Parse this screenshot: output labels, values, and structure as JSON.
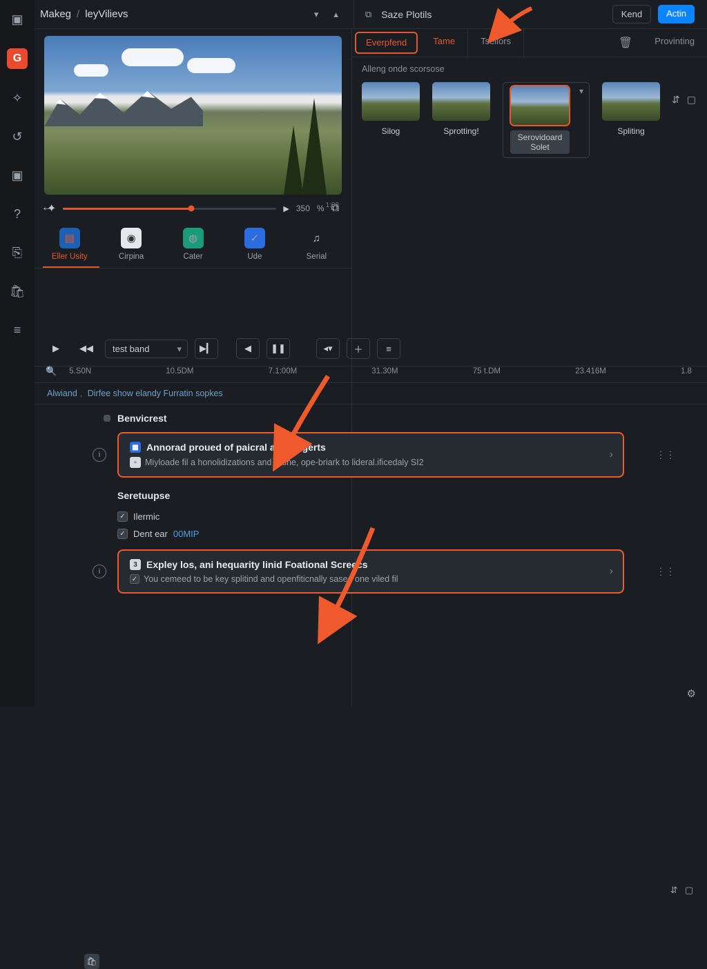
{
  "header": {
    "app_icon_label": "▣",
    "title_a": "Makeg",
    "title_b": "leyVilievs",
    "panel_title": "Saze Plotils",
    "btn_secondary": "Kend",
    "btn_primary": "Actin"
  },
  "left_rail": {
    "logo": "G",
    "items": [
      "settings",
      "refresh",
      "terminal",
      "help",
      "clipboard",
      "store",
      "menu"
    ]
  },
  "preview": {
    "scrub_value": "350",
    "scrub_unit": "%",
    "back_glyph": "←",
    "timecode": "1:00"
  },
  "tool_tabs": [
    {
      "label": "Eller Usity",
      "icon": "doc",
      "active": true
    },
    {
      "label": "Cirpina",
      "icon": "cam",
      "active": false
    },
    {
      "label": "Cater",
      "icon": "globe",
      "active": false
    },
    {
      "label": "Ude",
      "icon": "check",
      "active": false
    },
    {
      "label": "Serial",
      "icon": "music",
      "active": false
    }
  ],
  "transport": {
    "select_value": "test band"
  },
  "right_panel": {
    "tabs": [
      {
        "label": "Everpfend",
        "state": "active"
      },
      {
        "label": "Tame",
        "state": "hot"
      },
      {
        "label": "Tsellors",
        "state": ""
      },
      {
        "label": "Provinting",
        "state": ""
      }
    ],
    "sub_label": "Alleng onde scorsose",
    "thumbs": [
      {
        "label": "Silog",
        "selected": false
      },
      {
        "label": "Sprotting!",
        "selected": false
      },
      {
        "label": "Serovidoard Solet",
        "selected": true
      },
      {
        "label": "Spliting",
        "selected": false
      }
    ]
  },
  "timeline": {
    "ticks": [
      "5.S0N",
      "10.5DM",
      "7.1:00M",
      "31.30M",
      "75 t.DM",
      "23.416M",
      "1.8"
    ],
    "breadcrumb": [
      "Alwiand",
      "Dirfee show elandy Furratin sopkes"
    ],
    "section1": {
      "head": "Benvicrest",
      "card_title": "Annorad proued of paicral and brigerts",
      "card_sub": "Miyloade fil a honolidizations and Clshe, ope-briark to lideral.ificedaly SI2"
    },
    "section2": {
      "head": "Seretuupse",
      "check1_label": "Ilermic",
      "check2_label": "Dent ear",
      "check2_value": "00MIP",
      "card_title": "Expley los, ani hequarity linid Foational Screecs",
      "card_sub": "You cemeed to be key splitind and openfiticnally sased one viled fil"
    }
  },
  "glyphs": {
    "search": "🔍",
    "chev_down": "▾",
    "chev_up": "▴",
    "chev_right": "›",
    "play": "▶",
    "rewind": "◀◀",
    "prev": "◀",
    "pause": "❚❚",
    "next": "▶▎",
    "plus": "＋",
    "menu": "≡",
    "pick": "◂▾",
    "copy": "⧉",
    "wand": "✦",
    "cam": "◉",
    "globe": "◍",
    "check": "✓",
    "music": "♫",
    "doc": "📄",
    "delete": "🗑",
    "sort_v": "⇵",
    "box": "▢",
    "info": "i",
    "more": "⋮⋮",
    "settings": "⚙",
    "sliders": "⚙"
  }
}
